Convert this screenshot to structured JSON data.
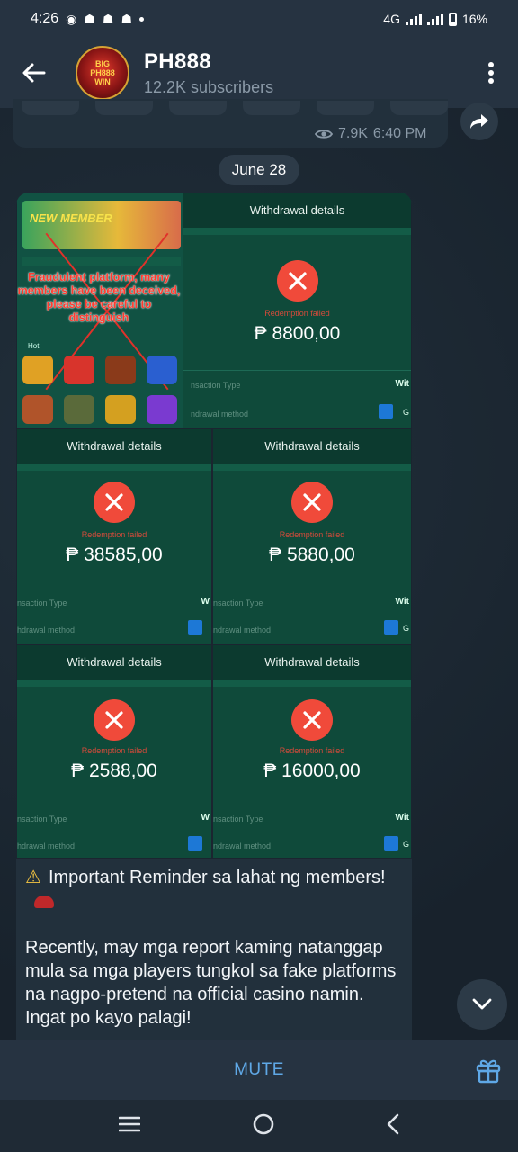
{
  "status_bar": {
    "time": "4:26",
    "network": "4G",
    "battery": "16%"
  },
  "header": {
    "title": "PH888",
    "subtitle": "12.2K subscribers",
    "avatar_text": [
      "BIG",
      "PH888",
      "WIN"
    ]
  },
  "previous_message": {
    "views": "7.9K",
    "time": "6:40 PM"
  },
  "date_separator": "June 28",
  "album": {
    "fake_site": {
      "banner": "NEW MEMBER",
      "warning": "Fraudulent platform, many members have been deceived, please be careful to distinguish",
      "hot_label": "Hot"
    },
    "withdrawals": [
      {
        "header": "Withdrawal details",
        "status": "Redemption failed",
        "amount": "₱ 8800,00",
        "type_label": "nsaction Type",
        "method_label": "ndrawal method",
        "w": "Wit",
        "g": "G"
      },
      {
        "header": "Withdrawal details",
        "status": "Redemption failed",
        "amount": "₱ 38585,00",
        "type_label": "nsaction Type",
        "method_label": "hdrawal method",
        "w": "W",
        "g": ""
      },
      {
        "header": "Withdrawal details",
        "status": "Redemption failed",
        "amount": "₱ 5880,00",
        "type_label": "nsaction Type",
        "method_label": "ndrawal method",
        "w": "Wit",
        "g": "G"
      },
      {
        "header": "Withdrawal details",
        "status": "Redemption failed",
        "amount": "₱ 2588,00",
        "type_label": "nsaction Type",
        "method_label": "hdrawal method",
        "w": "W",
        "g": ""
      },
      {
        "header": "Withdrawal details",
        "status": "Redemption failed",
        "amount": "₱ 16000,00",
        "type_label": "nsaction Type",
        "method_label": "ndrawal method",
        "w": "Wit",
        "g": "G"
      }
    ]
  },
  "message": {
    "line1": "Important Reminder sa lahat ng members!",
    "line2": "Recently, may mga report kaming natanggap mula sa mga players tungkol sa fake platforms na nagpo-pretend na official casino namin. Ingat po kayo palagi!"
  },
  "bottom_bar": {
    "mute_label": "MUTE"
  },
  "icons": {
    "back": "arrow-left-icon",
    "menu": "more-vertical-icon",
    "forward": "share-forward-icon",
    "scroll": "chevron-down-icon",
    "gift": "gift-icon",
    "warning": "warning-icon",
    "eye": "eye-icon"
  },
  "colors": {
    "accent": "#5fa8e6",
    "header_bg": "#263341",
    "bubble_bg": "#22303c",
    "fail_red": "#f04a3a",
    "receipt_green": "#0f4a3a"
  }
}
